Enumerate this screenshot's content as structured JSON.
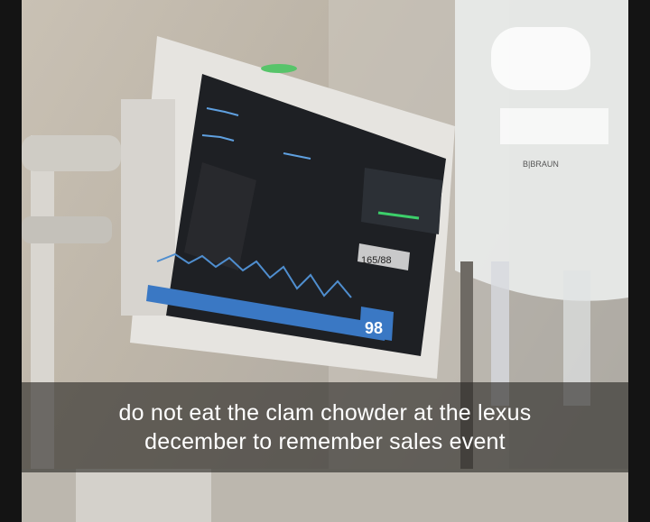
{
  "caption": {
    "line1": "do not eat the clam chowder at the lexus",
    "line2": "december to remember sales event"
  },
  "monitor": {
    "readout_small": "165/88",
    "readout_large": "98"
  },
  "iv_bag": {
    "label": "B|BRAUN"
  },
  "colors": {
    "caption_bg": "#28262480",
    "screen": "#1e2024",
    "trace_blue": "#5fa0e0",
    "trace_green": "#3ccf6a",
    "bar_blue": "#3a78c4"
  }
}
